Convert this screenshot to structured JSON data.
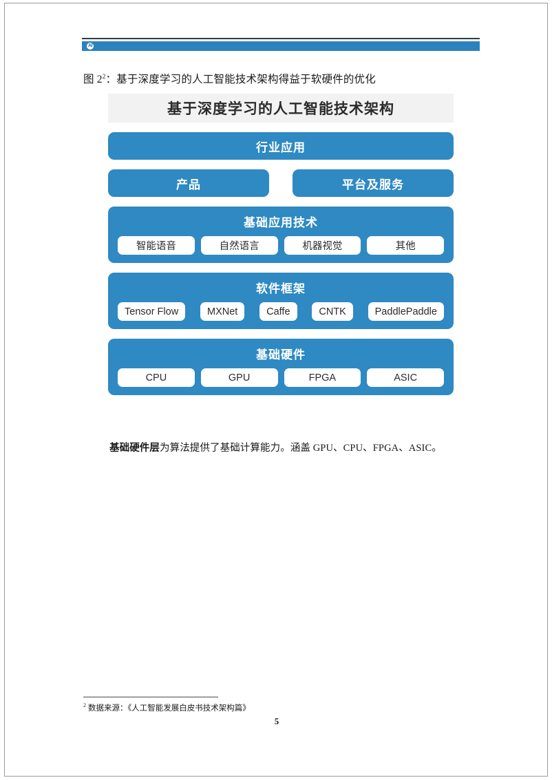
{
  "header": {
    "logo_text": "AI",
    "logo_icon": "ai-circle-logo",
    "bar_color": "#2c82bd",
    "rule_color": "#2f3b46"
  },
  "caption": {
    "prefix": "图 2",
    "footnote_marker": "2",
    "text": "：基于深度学习的人工智能技术架构得益于软硬件的优化"
  },
  "diagram": {
    "title": "基于深度学习的人工智能技术架构",
    "title_bg": "#f2f2f2",
    "band_color": "#2f89c2",
    "pill_color": "#ffffff",
    "layers": [
      {
        "id": "industry-application",
        "label": "行业应用",
        "type": "single"
      },
      {
        "id": "product-platform",
        "type": "double",
        "labels": [
          "产品",
          "平台及服务"
        ]
      },
      {
        "id": "foundational-application-technology",
        "type": "group",
        "label": "基础应用技术",
        "items": [
          "智能语音",
          "自然语言",
          "机器视觉",
          "其他"
        ]
      },
      {
        "id": "software-framework",
        "type": "group",
        "label": "软件框架",
        "items": [
          "Tensor Flow",
          "MXNet",
          "Caffe",
          "CNTK",
          "PaddlePaddle"
        ]
      },
      {
        "id": "foundational-hardware",
        "type": "group",
        "label": "基础硬件",
        "items": [
          "CPU",
          "GPU",
          "FPGA",
          "ASIC"
        ]
      }
    ]
  },
  "body": {
    "lead": "基础硬件层",
    "rest": "为算法提供了基础计算能力。涵盖 GPU、CPU、FPGA、ASIC。"
  },
  "footnote": {
    "marker": "2",
    "text": "数据来源：《人工智能发展白皮书技术架构篇》"
  },
  "page_number": "5"
}
